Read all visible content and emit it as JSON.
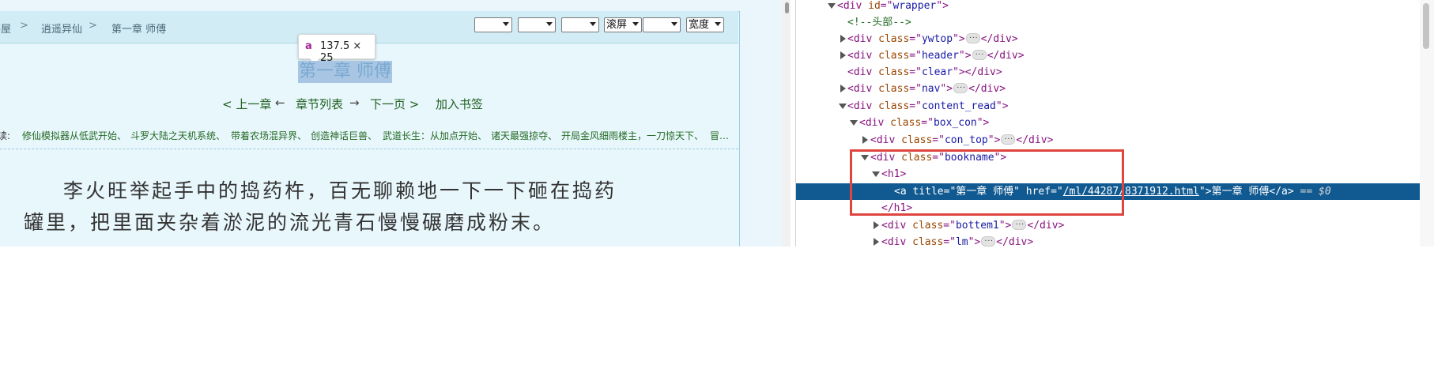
{
  "breadcrumb": {
    "home": "书屋",
    "book": "逍遥异仙",
    "chapter": "第一章 师傅",
    "sep": ">"
  },
  "controls": {
    "scroll_label": "滚屏",
    "width_label": "宽度"
  },
  "tooltip": {
    "tag": "a",
    "size": "137.5 × 25"
  },
  "chapter_title": "第一章 师傅",
  "chapter_nav": {
    "prev": "< 上一章",
    "arrow_left": "←",
    "toc": "章节列表",
    "arrow_right": "→",
    "next": "下一页 >",
    "bookmark": "加入书签"
  },
  "recommend": {
    "label": "读:",
    "items": [
      "修仙模拟器从低武开始、",
      "斗罗大陆之天机系统、",
      "带着农场混异界、",
      "创造神话巨兽、",
      "武道长生：从加点开始、",
      "诸天最强掠夺、",
      "开局金风细雨楼主，一刀惊天下、",
      "冒…"
    ]
  },
  "content": {
    "line1": "李火旺举起手中的捣药杵，百无聊赖地一下一下砸在捣药",
    "line2": "罐里，把里面夹杂着淤泥的流光青石慢慢碾磨成粉末。"
  },
  "devtools": {
    "rows": [
      {
        "t": "<div id=\"wrapper\">"
      },
      {
        "t": "<!--头部-->"
      },
      {
        "t": "<div class=\"ywtop\">…</div>"
      },
      {
        "t": "<div class=\"header\">…</div>"
      },
      {
        "t": "<div class=\"clear\"></div>"
      },
      {
        "t": "<div class=\"nav\">…</div>"
      },
      {
        "t": "<div class=\"content_read\">"
      },
      {
        "t": "<div class=\"box_con\">"
      },
      {
        "t": "<div class=\"con_top\">…</div>"
      },
      {
        "t": "<div class=\"bookname\">"
      },
      {
        "t": "<h1>"
      },
      {
        "t": "<a title=\"第一章 师傅\" href=\"/ml/44287/8371912.html\">第一章 师傅</a> == $0"
      },
      {
        "t": "</h1>"
      },
      {
        "t": "<div class=\"bottem1\">…</div>"
      },
      {
        "t": "<div class=\"lm\">…</div>"
      }
    ],
    "id_wrapper": "wrapper",
    "comment": "<!--头部-->",
    "cls_ywtop": "ywtop",
    "cls_header": "header",
    "cls_clear": "clear",
    "cls_nav": "nav",
    "cls_content_read": "content_read",
    "cls_box_con": "box_con",
    "cls_con_top": "con_top",
    "cls_bookname": "bookname",
    "a_title": "第一章 师傅",
    "a_href": "/ml/44287/8371912.html",
    "a_text": "第一章 师傅",
    "dollar": "== $0",
    "cls_bottem1": "bottem1",
    "cls_lm": "lm",
    "ellipsis": "···",
    "gutter_dots": "···"
  },
  "colors": {
    "highlight_box": "#e0443e",
    "selected_row": "#105a91",
    "title_highlight": "#a8c6e4"
  }
}
